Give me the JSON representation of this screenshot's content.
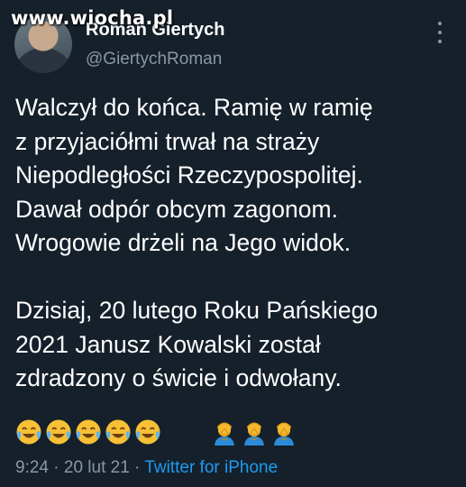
{
  "watermark": "www.wiocha.pl",
  "author": {
    "name": "Roman Giertych",
    "handle": "@GiertychRoman"
  },
  "tweet": {
    "lines": [
      "Walczył do końca. Ramię w ramię",
      "z przyjaciółmi trwał na straży",
      "Niepodległości Rzeczypospolitej.",
      "Dawał odpór obcym zagonom.",
      "Wrogowie drżeli na Jego widok.",
      "",
      "Dzisiaj, 20 lutego Roku Pańskiego",
      "2021 Janusz Kowalski został",
      "zdradzony o świcie i odwołany."
    ],
    "emojis": [
      "face-with-tears-of-joy-icon",
      "face-with-tears-of-joy-icon",
      "face-with-tears-of-joy-icon",
      "face-with-tears-of-joy-icon",
      "face-with-tears-of-joy-icon",
      "man-facepalming-icon",
      "man-facepalming-icon",
      "man-facepalming-icon"
    ]
  },
  "meta": {
    "time": "9:24",
    "separator1": " · ",
    "date": "20 lut 21",
    "separator2": " · ",
    "source": "Twitter for iPhone"
  },
  "colors": {
    "background": "#15202b",
    "text": "#ffffff",
    "muted": "#8b98a5",
    "link": "#1d9bf0"
  }
}
